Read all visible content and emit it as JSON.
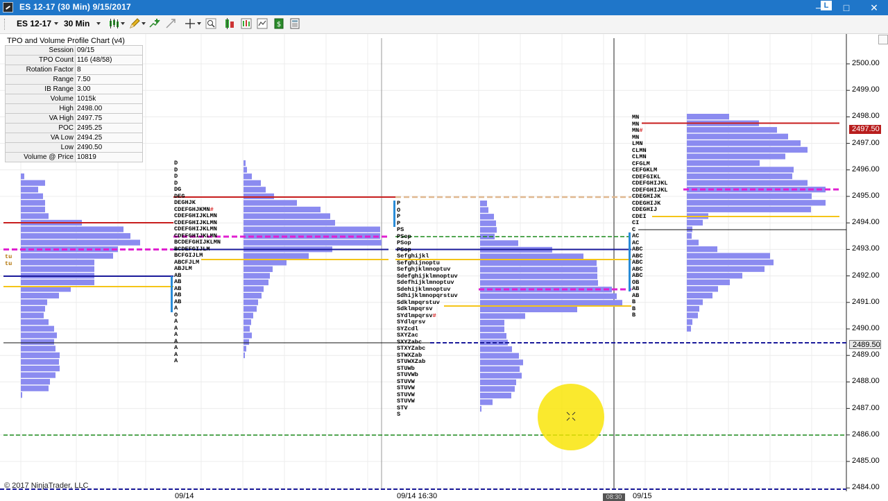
{
  "window": {
    "title": "ES 12-17 (30 Min)  9/15/2017",
    "controls": {
      "minimize": "─",
      "maximize": "□",
      "close": "✕"
    },
    "badge": "L"
  },
  "toolbar": {
    "instrument": "ES 12-17",
    "interval": "30 Min",
    "icons": [
      "candlestick-icon",
      "pencil-draw-icon",
      "add-indicator-icon",
      "strategy-icon",
      "crosshair-icon",
      "zoom-icon",
      "bar-type-icon",
      "chart-trader-icon",
      "properties-icon",
      "data-box-icon",
      "window-linking-icon"
    ]
  },
  "indicator": {
    "name": "TPO and Volume Profile Chart (v4)",
    "rows": [
      {
        "label": "Session",
        "value": "09/15"
      },
      {
        "label": "TPO Count",
        "value": "116 (48/58)"
      },
      {
        "label": "Rotation Factor",
        "value": "8"
      },
      {
        "label": "Range",
        "value": "7.50"
      },
      {
        "label": "IB Range",
        "value": "3.00"
      },
      {
        "label": "Volume",
        "value": "1015k"
      },
      {
        "label": "High",
        "value": "2498.00"
      },
      {
        "label": "VA High",
        "value": "2497.75"
      },
      {
        "label": "POC",
        "value": "2495.25"
      },
      {
        "label": "VA Low",
        "value": "2494.25"
      },
      {
        "label": "Low",
        "value": "2490.50"
      },
      {
        "label": "Volume @ Price",
        "value": "10819"
      }
    ]
  },
  "y_axis": {
    "labels": [
      "2500.00",
      "2499.00",
      "2498.00",
      "2497.00",
      "2496.00",
      "2495.00",
      "2494.00",
      "2493.00",
      "2492.00",
      "2491.00",
      "2490.00",
      "2489.00",
      "2488.00",
      "2487.00",
      "2486.00",
      "2485.00",
      "2484.00"
    ],
    "current_price": "2497.50",
    "marker_price": "2489.50"
  },
  "x_axis": {
    "labels": [
      "09/14",
      "09/14 16:30",
      "09/15"
    ],
    "crosshair_time": "08:30"
  },
  "copyright": "© 2017 NinjaTrader, LLC",
  "colors": {
    "titlebar": "#1f76c9",
    "profile_bar": "#8b8bf0",
    "poc_line": "#c81e1e",
    "value_area_line": "#f5c518",
    "vwap_dash": "#e020d0",
    "ib_line": "#2a8cd8",
    "green_dash": "#1a8a1a",
    "navy_line": "#1a1a9a",
    "cursor_highlight": "#f9e400"
  },
  "tpo_profiles": [
    {
      "rows": [
        "D",
        "D",
        "D",
        "D",
        "DG",
        "DEG",
        "DEGHJK",
        "CDEFGHJKMN#",
        "CDEFGHIJKLMN",
        "CDEFGHIJKLMN",
        "CDEFGHIJKLMN",
        "CDEFGHIJKLMN",
        "BCDEFGHIJKLMN",
        "BCDEFGIJLM",
        "BCFGIJLM",
        "ABCFJLM",
        "ABJLM",
        "AB",
        "AB",
        "AB",
        "AB",
        "AB",
        "A",
        "O",
        "A",
        "A",
        "A",
        "A",
        "A",
        "A",
        "A"
      ]
    },
    {
      "rows": [
        "P",
        "O",
        "P",
        "P",
        "PS",
        "PSop",
        "PSop",
        "PSop",
        "Sefghijkl",
        "Sefghijnoptu",
        "Sefghjklmnoptuv",
        "Sdefghijklmnoptuv",
        "Sdefhijklmnoptuv",
        "Sdehijklmnoptuv",
        "Sdhijklmnopqrstuv",
        "Sdklmpqrstuv",
        "Sdklmpqrsv",
        "SYdlmpqrsv#",
        "SYdlqrsv",
        "SYZcdl",
        "SXYZac",
        "SXYZabc",
        "STXYZabc",
        "STWXZab",
        "STUWXZab",
        "STUWb",
        "STUVWb",
        "STUVW",
        "STUVW",
        "STUVW",
        "STUVW",
        "STV",
        "S"
      ]
    },
    {
      "rows": [
        "MN",
        "MN",
        "MN#",
        "MN",
        "LMN",
        "CLMN",
        "CLMN",
        "CFGLM",
        "CEFGKLM",
        "CDEFGIKL",
        "CDEFGHIJKL",
        "CDEFGHIJKL",
        "CDEGHIJK",
        "CDEGHIJK",
        "CDEGHIJ",
        "CDEI",
        "CI",
        "C",
        "AC",
        "AC",
        "ABC",
        "ABC",
        "ABC",
        "ABC",
        "ABC",
        "OB",
        "AB",
        "AB",
        "B",
        "B",
        "B"
      ]
    }
  ],
  "tpo_edge_labels": [
    "tu",
    "tu"
  ]
}
